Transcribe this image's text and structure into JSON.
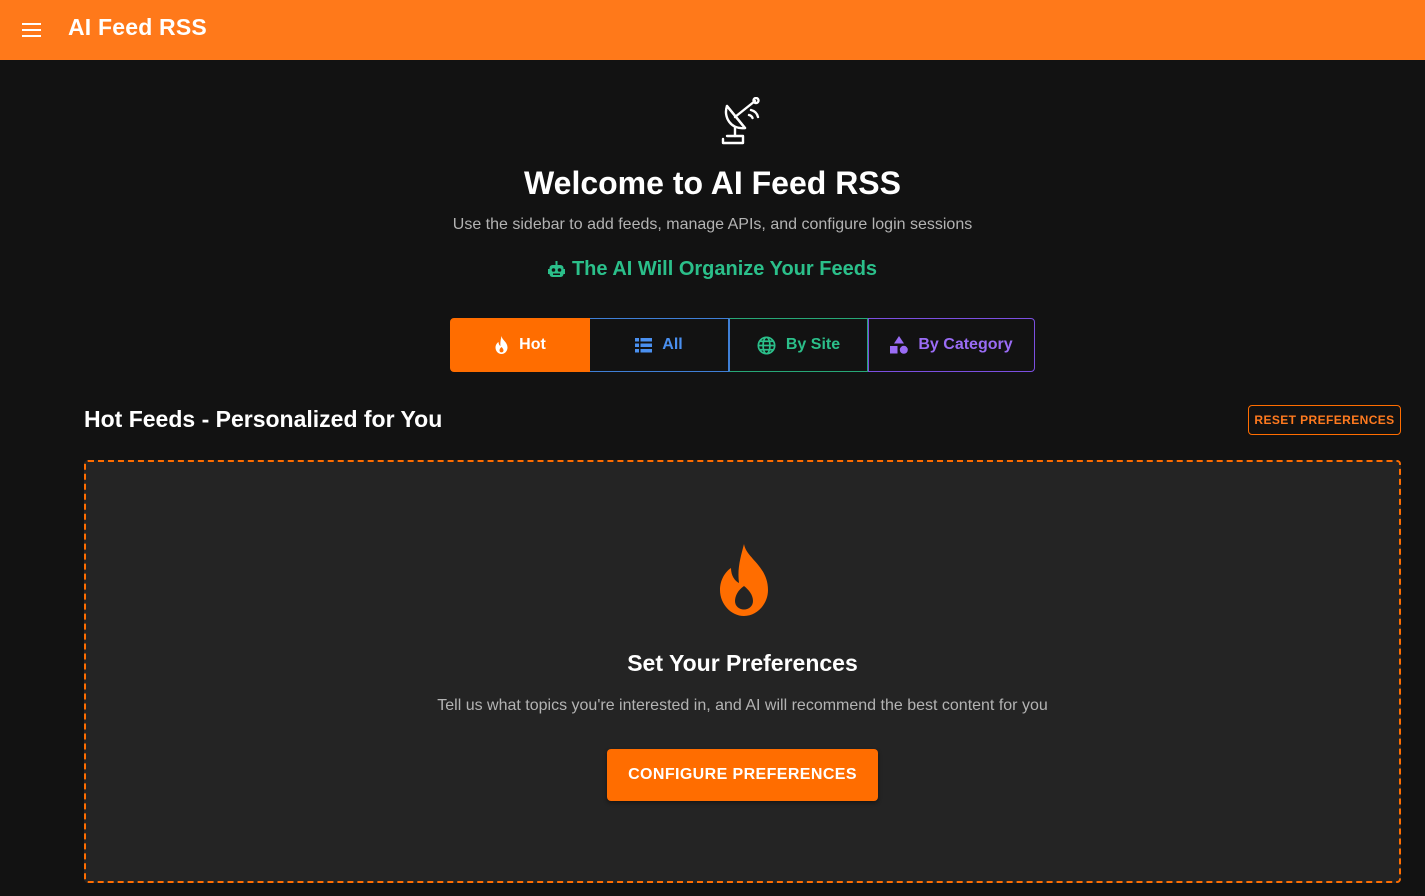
{
  "app": {
    "title": "AI Feed RSS",
    "menu_icon": "menu-icon",
    "brand_color": "#ff791a"
  },
  "hero": {
    "icon": "satellite-dish-icon",
    "title": "Welcome to AI Feed RSS",
    "subtitle": "Use the sidebar to add feeds, manage APIs, and configure login sessions",
    "ai_icon": "robot-icon",
    "ai_text": "The AI Will Organize Your Feeds",
    "ai_color": "#2bbf8a"
  },
  "tabs": [
    {
      "label": "Hot",
      "icon": "fire-icon",
      "active": true,
      "color": "#ff6d00"
    },
    {
      "label": "All",
      "icon": "list-icon",
      "active": false,
      "color": "#4a90f0"
    },
    {
      "label": "By Site",
      "icon": "globe-icon",
      "active": false,
      "color": "#2bbf8a"
    },
    {
      "label": "By Category",
      "icon": "shapes-icon",
      "active": false,
      "color": "#9a6cf5"
    }
  ],
  "section": {
    "title": "Hot Feeds - Personalized for You",
    "reset_label": "RESET PREFERENCES"
  },
  "empty_state": {
    "icon": "fire-icon",
    "title": "Set Your Preferences",
    "text": "Tell us what topics you're interested in, and AI will recommend the best content for you",
    "button_label": "CONFIGURE PREFERENCES",
    "accent": "#ff6d00"
  }
}
